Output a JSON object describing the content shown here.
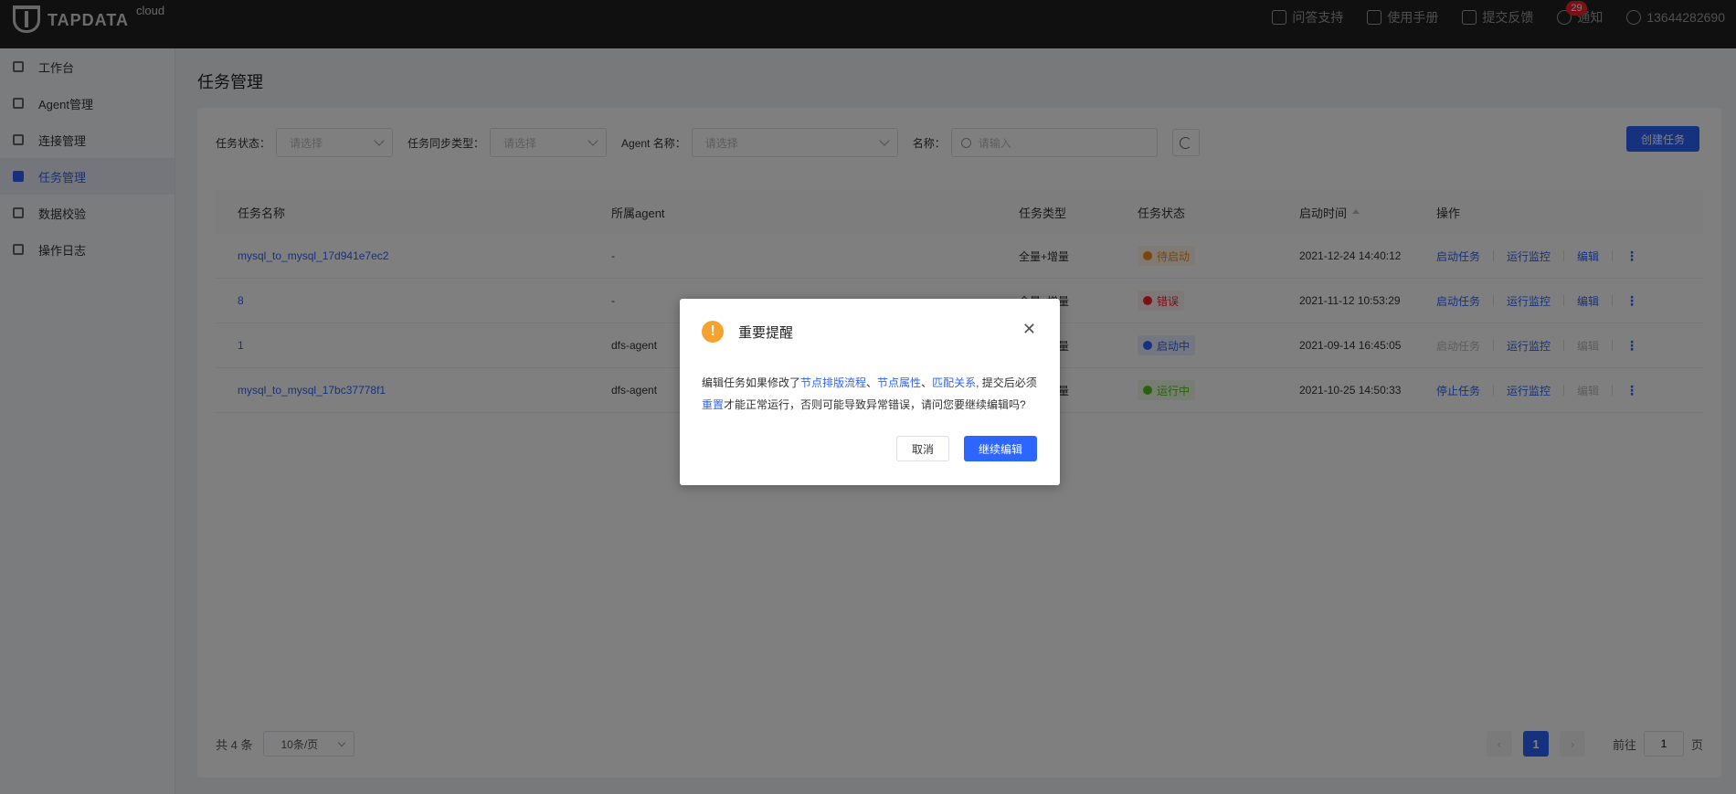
{
  "header": {
    "logo_text": "TAPDATA",
    "logo_sub": "cloud",
    "actions": [
      {
        "label": "问答支持",
        "icon": "question-icon"
      },
      {
        "label": "使用手册",
        "icon": "paper-plane-icon"
      },
      {
        "label": "提交反馈",
        "icon": "edit-icon"
      },
      {
        "label": "通知",
        "icon": "bell-icon",
        "badge": "29"
      },
      {
        "label": "13644282690",
        "icon": "user-icon"
      }
    ]
  },
  "sidebar": {
    "items": [
      {
        "label": "工作台",
        "icon": "dashboard-icon",
        "active": false
      },
      {
        "label": "Agent管理",
        "icon": "list-icon",
        "active": false
      },
      {
        "label": "连接管理",
        "icon": "link-icon",
        "active": false
      },
      {
        "label": "任务管理",
        "icon": "task-icon",
        "active": true
      },
      {
        "label": "数据校验",
        "icon": "check-icon",
        "active": false
      },
      {
        "label": "操作日志",
        "icon": "log-icon",
        "active": false
      }
    ]
  },
  "page": {
    "title": "任务管理"
  },
  "filters": {
    "status_label": "任务状态：",
    "status_placeholder": "请选择",
    "sync_type_label": "任务同步类型：",
    "sync_type_placeholder": "请选择",
    "agent_label": "Agent 名称：",
    "agent_placeholder": "请选择",
    "name_label": "名称：",
    "name_placeholder": "请输入",
    "create_button": "创建任务"
  },
  "table": {
    "headers": [
      "任务名称",
      "所属agent",
      "任务类型",
      "任务状态",
      "启动时间",
      "操作"
    ],
    "rows": [
      {
        "name": "mysql_to_mysql_17d941e7ec2",
        "agent": "-",
        "type": "全量+增量",
        "status": "待启动",
        "status_color": "#fa8c16",
        "status_bg": "#fff4e6",
        "time": "2021-12-24 14:40:12",
        "action1": "启动任务",
        "action1_disabled": false,
        "action2": "运行监控",
        "action3": "编辑",
        "action3_disabled": false
      },
      {
        "name": "8",
        "agent": "-",
        "type": "全量+增量",
        "status": "错误",
        "status_color": "#f5222d",
        "status_bg": "#fff1f0",
        "time": "2021-11-12 10:53:29",
        "action1": "启动任务",
        "action1_disabled": false,
        "action2": "运行监控",
        "action3": "编辑",
        "action3_disabled": false
      },
      {
        "name": "1",
        "agent": "dfs-agent",
        "type": "全量+增量",
        "status": "启动中",
        "status_color": "#2c65ff",
        "status_bg": "#e8efff",
        "time": "2021-09-14 16:45:05",
        "action1": "启动任务",
        "action1_disabled": true,
        "action2": "运行监控",
        "action3": "编辑",
        "action3_disabled": true
      },
      {
        "name": "mysql_to_mysql_17bc37778f1",
        "agent": "dfs-agent",
        "type": "全量+增量",
        "status": "运行中",
        "status_color": "#52c41a",
        "status_bg": "#eefbe6",
        "time": "2021-10-25 14:50:33",
        "action1": "停止任务",
        "action1_disabled": false,
        "action2": "运行监控",
        "action3": "编辑",
        "action3_disabled": true
      }
    ]
  },
  "footer": {
    "total": "共 4 条",
    "page_size": "10条/页",
    "current_page": "1",
    "goto_label": "前往",
    "goto_value": "1",
    "page_suffix": "页"
  },
  "dialog": {
    "title": "重要提醒",
    "body_1": "编辑任务如果修改了",
    "hl_1": "节点排版流程",
    "sep_1": "、",
    "hl_2": "节点属性",
    "sep_2": "、",
    "hl_3": "匹配关系",
    "body_2": ", 提交后必须",
    "hl_4": "重置",
    "body_3": "才能正常运行，否则可能导致异常错误，请问您要继续编辑吗?",
    "cancel": "取消",
    "confirm": "继续编辑"
  }
}
